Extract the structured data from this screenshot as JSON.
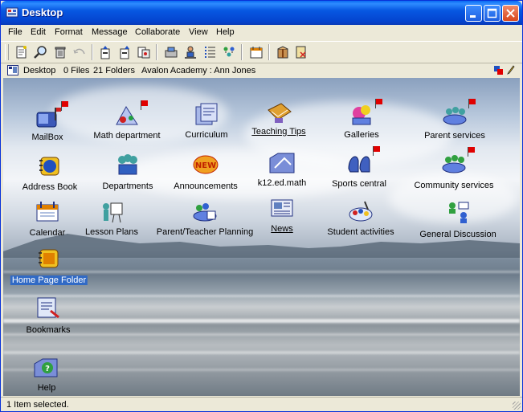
{
  "window": {
    "title": "Desktop"
  },
  "menu": [
    "File",
    "Edit",
    "Format",
    "Message",
    "Collaborate",
    "View",
    "Help"
  ],
  "toolbar": {
    "buttons": [
      "new-document-icon",
      "search-icon",
      "trash-icon",
      "reply-icon",
      "upload-icon",
      "download-icon",
      "copy-icon",
      "network-icon",
      "user-icon",
      "list-icon",
      "people-icon",
      "calendar-icon",
      "package-icon",
      "close-doc-icon"
    ]
  },
  "address": {
    "location": "Desktop",
    "files": "0 Files",
    "folders": "21 Folders",
    "context": "Avalon Academy : Ann Jones"
  },
  "icons": [
    {
      "label": "MailBox",
      "flag": true,
      "link": false
    },
    {
      "label": "Math department",
      "flag": true,
      "link": false
    },
    {
      "label": "Curriculum",
      "flag": false,
      "link": false
    },
    {
      "label": "Teaching Tips",
      "flag": false,
      "link": true
    },
    {
      "label": "Galleries",
      "flag": true,
      "link": false
    },
    {
      "label": "Parent services",
      "flag": true,
      "link": false
    },
    {
      "label": "Address Book",
      "flag": false,
      "link": false
    },
    {
      "label": "Departments",
      "flag": false,
      "link": false
    },
    {
      "label": "Announcements",
      "flag": false,
      "link": false
    },
    {
      "label": "k12.ed.math",
      "flag": false,
      "link": false
    },
    {
      "label": "Sports central",
      "flag": true,
      "link": false
    },
    {
      "label": "Community services",
      "flag": true,
      "link": false
    },
    {
      "label": "Calendar",
      "flag": false,
      "link": false
    },
    {
      "label": "Lesson Plans",
      "flag": false,
      "link": false
    },
    {
      "label": "Parent/Teacher Planning",
      "flag": false,
      "link": false
    },
    {
      "label": "News",
      "flag": false,
      "link": true
    },
    {
      "label": "Student activities",
      "flag": false,
      "link": false
    },
    {
      "label": "General Discussion",
      "flag": false,
      "link": false
    },
    {
      "label": "Home Page Folder",
      "flag": false,
      "link": false,
      "selected": true
    },
    {
      "label": "Bookmarks",
      "flag": false,
      "link": false
    },
    {
      "label": "Help",
      "flag": false,
      "link": false
    }
  ],
  "status": {
    "text": "1 Item selected."
  },
  "colors": {
    "titlebar": "#0A5AE0",
    "selection": "#316AC5",
    "flag": "#E00000"
  }
}
